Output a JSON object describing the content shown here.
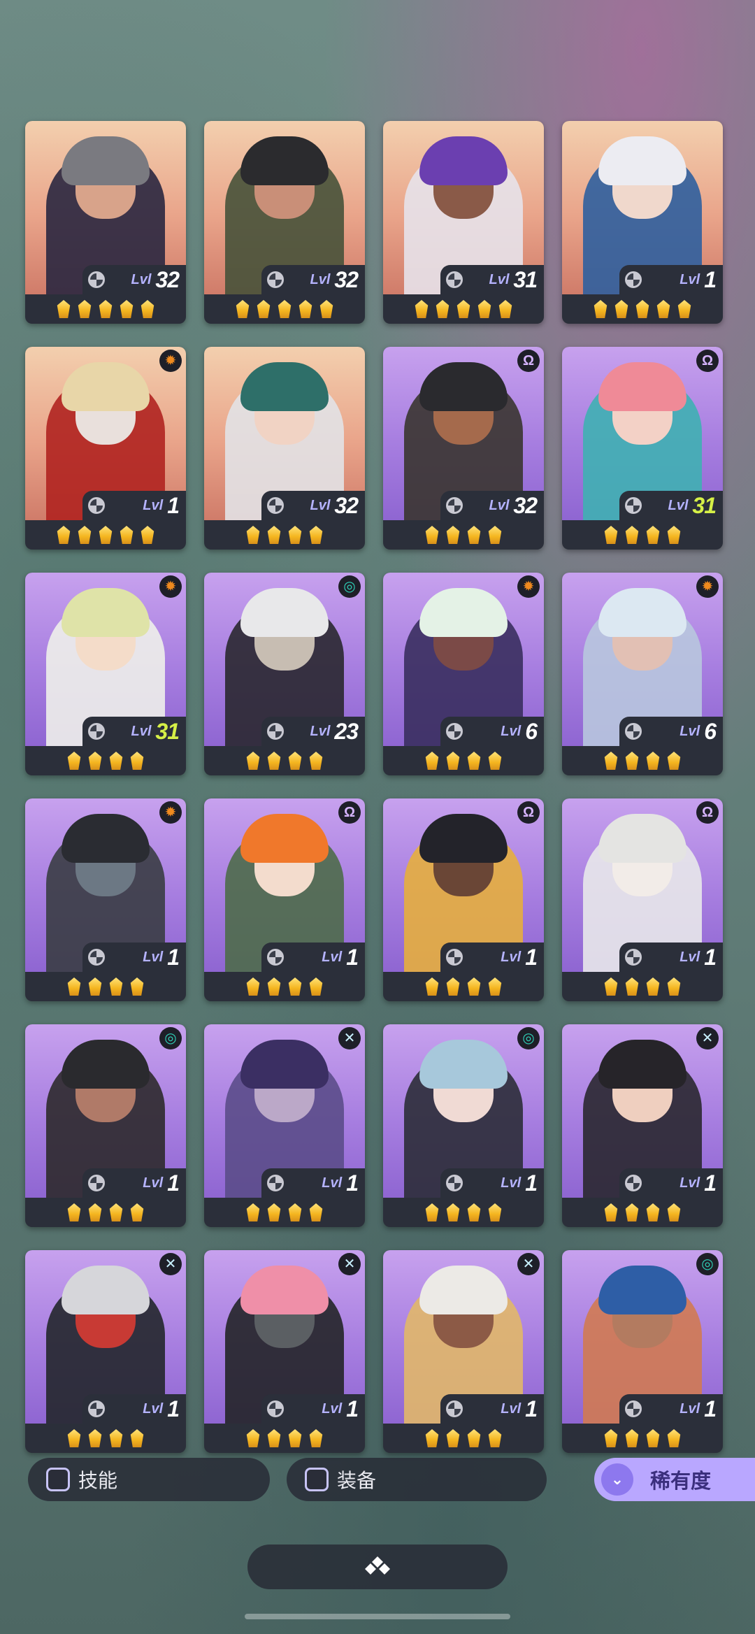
{
  "heroes": [
    {
      "level": "32",
      "stars": 5,
      "bg": "warm",
      "class_icon": "",
      "skin": "#d8a38a",
      "hair": "#7a7a80",
      "outfit": "#2a2740"
    },
    {
      "level": "32",
      "stars": 5,
      "bg": "warm",
      "class_icon": "",
      "skin": "#c98f78",
      "hair": "#2b2b2e",
      "outfit": "#47523a"
    },
    {
      "level": "31",
      "stars": 5,
      "bg": "warm",
      "class_icon": "",
      "skin": "#8a5a48",
      "hair": "#6b3fb0",
      "outfit": "#e7e2ea"
    },
    {
      "level": "1",
      "stars": 5,
      "bg": "warm",
      "class_icon": "",
      "skin": "#f0d8cc",
      "hair": "#ececf2",
      "outfit": "#2f5f9e"
    },
    {
      "level": "1",
      "stars": 5,
      "bg": "warm",
      "class_icon": "sun",
      "skin": "#e9e0dc",
      "hair": "#e8d6a8",
      "outfit": "#b02320"
    },
    {
      "level": "32",
      "stars": 4,
      "bg": "warm",
      "class_icon": "",
      "skin": "#f1d3c4",
      "hair": "#2e6f69",
      "outfit": "#e2e2e6"
    },
    {
      "level": "32",
      "stars": 4,
      "bg": "purple",
      "class_icon": "omega",
      "skin": "#a56a4c",
      "hair": "#2a2a2e",
      "outfit": "#3a3530"
    },
    {
      "level": "31",
      "stars": 4,
      "bg": "purple",
      "class_icon": "omega",
      "skin": "#f3d1c6",
      "hair": "#ef8a97",
      "outfit": "#3fb0b2"
    },
    {
      "level": "31",
      "stars": 4,
      "bg": "purple",
      "class_icon": "sun",
      "skin": "#f4dcc9",
      "hair": "#dfe3a8",
      "outfit": "#eef0ea"
    },
    {
      "level": "23",
      "stars": 4,
      "bg": "purple",
      "class_icon": "swirl",
      "skin": "#c7bdb2",
      "hair": "#e8e8ea",
      "outfit": "#2a2830"
    },
    {
      "level": "6",
      "stars": 4,
      "bg": "purple",
      "class_icon": "sun",
      "skin": "#7b4a47",
      "hair": "#e4f2e6",
      "outfit": "#3a2f5f"
    },
    {
      "level": "6",
      "stars": 4,
      "bg": "purple",
      "class_icon": "sun",
      "skin": "#e2c0b4",
      "hair": "#dce8f2",
      "outfit": "#b8c6de"
    },
    {
      "level": "1",
      "stars": 4,
      "bg": "purple",
      "class_icon": "sun",
      "skin": "#6c7884",
      "hair": "#2a2c32",
      "outfit": "#3a3d44"
    },
    {
      "level": "1",
      "stars": 4,
      "bg": "purple",
      "class_icon": "omega",
      "skin": "#f3dccd",
      "hair": "#f0782b",
      "outfit": "#4e6b4a"
    },
    {
      "level": "1",
      "stars": 4,
      "bg": "purple",
      "class_icon": "omega",
      "skin": "#6a4636",
      "hair": "#23232a",
      "outfit": "#e6ae3e"
    },
    {
      "level": "1",
      "stars": 4,
      "bg": "purple",
      "class_icon": "omega",
      "skin": "#f2ece8",
      "hair": "#e4e4e2",
      "outfit": "#e8e8ea"
    },
    {
      "level": "1",
      "stars": 4,
      "bg": "purple",
      "class_icon": "swirl",
      "skin": "#b07a68",
      "hair": "#2a2a2e",
      "outfit": "#2e2a2c"
    },
    {
      "level": "1",
      "stars": 4,
      "bg": "purple",
      "class_icon": "cross",
      "skin": "#bba8c8",
      "hair": "#3b2f63",
      "outfit": "#5b4c8a"
    },
    {
      "level": "1",
      "stars": 4,
      "bg": "purple",
      "class_icon": "swirl",
      "skin": "#f0dad4",
      "hair": "#a7c8db",
      "outfit": "#2c2e38"
    },
    {
      "level": "1",
      "stars": 4,
      "bg": "purple",
      "class_icon": "cross",
      "skin": "#efcfbf",
      "hair": "#262429",
      "outfit": "#2a2830"
    },
    {
      "level": "1",
      "stars": 4,
      "bg": "purple",
      "class_icon": "cross",
      "skin": "#c83a34",
      "hair": "#d6d6da",
      "outfit": "#24272c"
    },
    {
      "level": "1",
      "stars": 4,
      "bg": "purple",
      "class_icon": "cross",
      "skin": "#5b5f63",
      "hair": "#ef8fa8",
      "outfit": "#232528"
    },
    {
      "level": "1",
      "stars": 4,
      "bg": "purple",
      "class_icon": "cross",
      "skin": "#8c5a46",
      "hair": "#eceae6",
      "outfit": "#e1b769"
    },
    {
      "level": "1",
      "stars": 4,
      "bg": "purple",
      "class_icon": "swirl",
      "skin": "#b37b60",
      "hair": "#2e5ea6",
      "outfit": "#d07a52"
    }
  ],
  "green_level_indices": [
    7,
    8
  ],
  "level_prefix": "Lvl",
  "class_icon_colors": {
    "sun": "#f08a1e",
    "omega": "#d7b5ff",
    "swirl": "#2fd0b7",
    "cross": "#c9f1ff"
  },
  "filters": {
    "skill_label": "技能",
    "equip_label": "装备",
    "rarity_label": "稀有度"
  },
  "bottom_pill_icon": "diamond-cluster-icon"
}
